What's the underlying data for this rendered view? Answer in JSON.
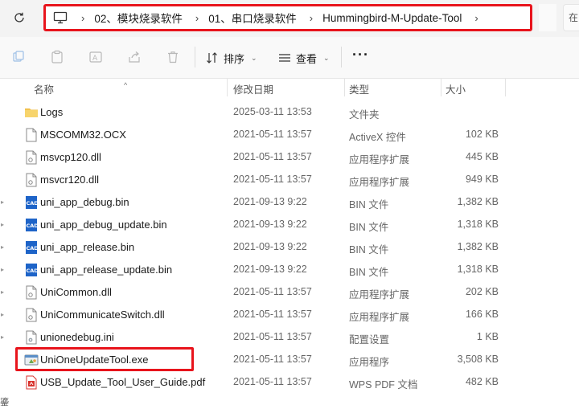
{
  "address_bar": {
    "breadcrumbs": [
      "02、模块烧录软件",
      "01、串口烧录软件",
      "Hummingbird-M-Update-Tool"
    ],
    "search_stub": "在"
  },
  "toolbar": {
    "sort_label": "排序",
    "view_label": "查看",
    "more_label": "···"
  },
  "columns": {
    "name": "名称",
    "date": "修改日期",
    "type": "类型",
    "size": "大小"
  },
  "files": [
    {
      "name": "Logs",
      "date": "2025-03-11 13:53",
      "type": "文件夹",
      "size": "",
      "icon": "folder-icon"
    },
    {
      "name": "MSCOMM32.OCX",
      "date": "2021-05-11 13:57",
      "type": "ActiveX 控件",
      "size": "102 KB",
      "icon": "file-icon"
    },
    {
      "name": "msvcp120.dll",
      "date": "2021-05-11 13:57",
      "type": "应用程序扩展",
      "size": "445 KB",
      "icon": "dll-file-icon"
    },
    {
      "name": "msvcr120.dll",
      "date": "2021-05-11 13:57",
      "type": "应用程序扩展",
      "size": "949 KB",
      "icon": "dll-file-icon"
    },
    {
      "name": "uni_app_debug.bin",
      "date": "2021-09-13 9:22",
      "type": "BIN 文件",
      "size": "1,382 KB",
      "icon": "cad-file-icon"
    },
    {
      "name": "uni_app_debug_update.bin",
      "date": "2021-09-13 9:22",
      "type": "BIN 文件",
      "size": "1,318 KB",
      "icon": "cad-file-icon"
    },
    {
      "name": "uni_app_release.bin",
      "date": "2021-09-13 9:22",
      "type": "BIN 文件",
      "size": "1,382 KB",
      "icon": "cad-file-icon"
    },
    {
      "name": "uni_app_release_update.bin",
      "date": "2021-09-13 9:22",
      "type": "BIN 文件",
      "size": "1,318 KB",
      "icon": "cad-file-icon"
    },
    {
      "name": "UniCommon.dll",
      "date": "2021-05-11 13:57",
      "type": "应用程序扩展",
      "size": "202 KB",
      "icon": "dll-file-icon"
    },
    {
      "name": "UniCommunicateSwitch.dll",
      "date": "2021-05-11 13:57",
      "type": "应用程序扩展",
      "size": "166 KB",
      "icon": "dll-file-icon"
    },
    {
      "name": "unionedebug.ini",
      "date": "2021-05-11 13:57",
      "type": "配置设置",
      "size": "1 KB",
      "icon": "ini-file-icon"
    },
    {
      "name": "UniOneUpdateTool.exe",
      "date": "2021-05-11 13:57",
      "type": "应用程序",
      "size": "3,508 KB",
      "icon": "exe-app-icon"
    },
    {
      "name": "USB_Update_Tool_User_Guide.pdf",
      "date": "2021-05-11 13:57",
      "type": "WPS PDF 文档",
      "size": "482 KB",
      "icon": "pdf-file-icon"
    }
  ],
  "nav_stub_text": "鎏",
  "colors": {
    "highlight": "#e8141c",
    "folder": "#f2c14e",
    "cad_blue": "#1e64c8",
    "pdf_red": "#d8322c"
  }
}
